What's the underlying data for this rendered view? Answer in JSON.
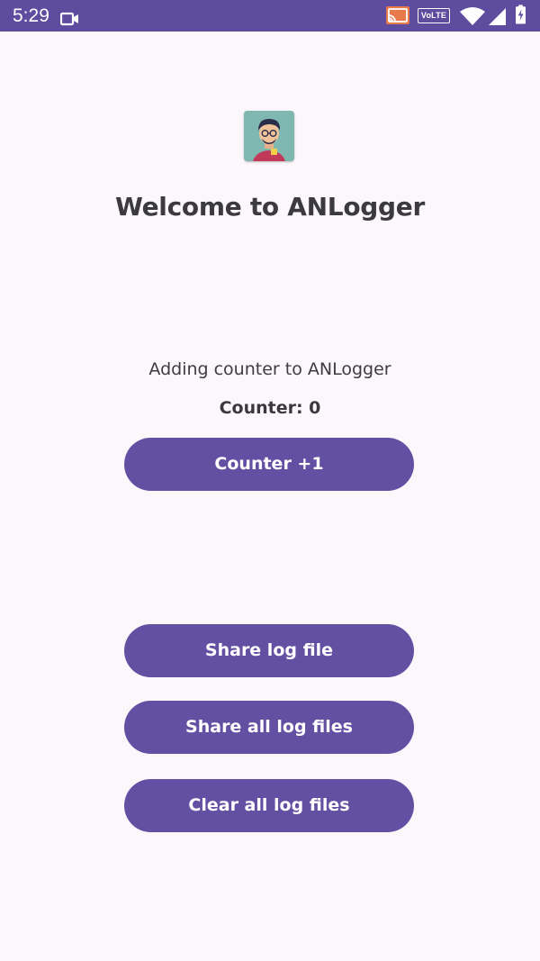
{
  "status_bar": {
    "time": "5:29",
    "volte_label": "VoLTE",
    "background_color": "#5e4c9e",
    "icons": [
      "video-camera-icon",
      "cast-icon",
      "volte-icon",
      "wifi-icon",
      "cell-signal-icon",
      "battery-icon"
    ]
  },
  "app": {
    "title": "Welcome to ANLogger",
    "logo_icon": "developer-avatar-icon"
  },
  "counter": {
    "caption": "Adding counter to ANLogger",
    "value_text": "Counter: 0",
    "increment_label": "Counter +1"
  },
  "actions": {
    "share_log_label": "Share log file",
    "share_all_label": "Share all log files",
    "clear_all_label": "Clear all log files"
  },
  "colors": {
    "accent": "#6450a3",
    "background": "#fcf7fb",
    "text": "#3b3b3f"
  }
}
